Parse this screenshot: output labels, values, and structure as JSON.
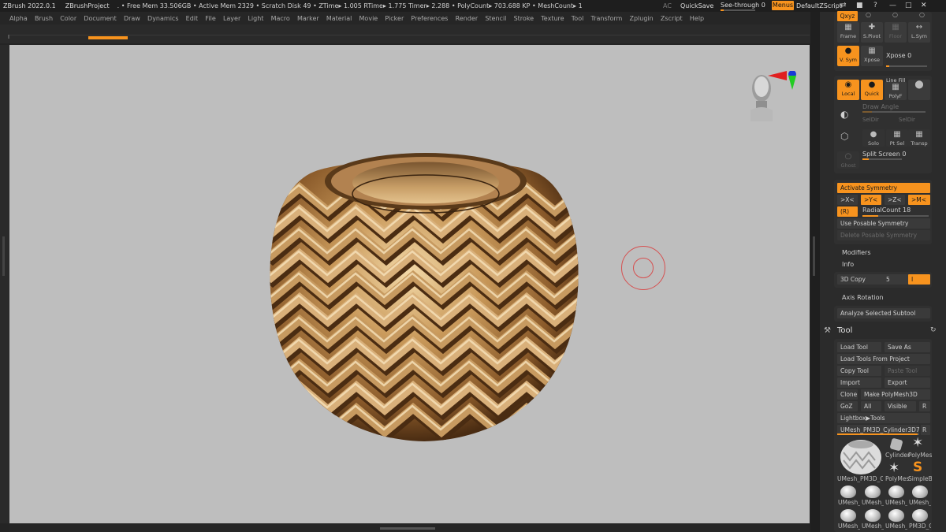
{
  "titlebar": {
    "app": "ZBrush 2022.0.1",
    "project": "ZBrushProject",
    "stats": ". • Free Mem 33.506GB • Active Mem 2329 • Scratch Disk 49 • ZTime▸ 1.005 RTime▸ 1.775 Timer▸ 2.288 • PolyCount▸ 703.688 KP • MeshCount▸ 1",
    "ac": "AC",
    "quicksave": "QuickSave",
    "see_through": "See-through  0",
    "menus": "Menus",
    "default_zscript": "DefaultZScript"
  },
  "menubar": [
    "Alpha",
    "Brush",
    "Color",
    "Document",
    "Draw",
    "Dynamics",
    "Edit",
    "File",
    "Layer",
    "Light",
    "Macro",
    "Marker",
    "Material",
    "Movie",
    "Picker",
    "Preferences",
    "Render",
    "Stencil",
    "Stroke",
    "Texture",
    "Tool",
    "Transform",
    "Zplugin",
    "Zscript",
    "Help"
  ],
  "transform": {
    "xyz": "Qxyz",
    "frame": "Frame",
    "s_pivot": "S.Pivot",
    "floor": "Floor",
    "l_sym": "L.Sym",
    "v_sym": "V. Sym",
    "xpose_btn": "Xpose",
    "xpose_slider": "Xpose 0",
    "local": "Local",
    "quick": "Quick",
    "line_fill": "Line Fill",
    "polyf": "PolyF",
    "draw_angle": "Draw Angle",
    "sel_dir_a": "SelDir",
    "sel_dir_b": "SelDir",
    "solo": "Solo",
    "pt_sel": "Pt Sel",
    "transp": "Transp",
    "ghost": "Ghost",
    "split_screen": "Split Screen 0",
    "activate_symmetry": "Activate Symmetry",
    "x_axis": ">X<",
    "y_axis": ">Y<",
    "z_axis": ">Z<",
    "m_axis": ">M<",
    "radial_r": "(R)",
    "radial_count": "RadialCount 18",
    "use_posable": "Use Posable Symmetry",
    "delete_posable": "Delete Posable Symmetry",
    "modifiers": "Modifiers",
    "info": "Info",
    "copy_3d": "3D Copy",
    "copy_3d_val": "5",
    "copy_3d_flag": "I",
    "axis_rotation": "Axis Rotation",
    "analyze": "Analyze Selected Subtool"
  },
  "tool": {
    "header": "Tool",
    "load_tool": "Load Tool",
    "save_as": "Save As",
    "load_from_project": "Load Tools From Project",
    "copy_tool": "Copy Tool",
    "paste_tool": "Paste Tool",
    "import": "Import",
    "export": "Export",
    "clone": "Clone",
    "make_polymesh": "Make PolyMesh3D",
    "goz": "GoZ",
    "all": "All",
    "visible": "Visible",
    "r": "R",
    "lightbox": "Lightbox▶Tools",
    "current": "UMesh_PM3D_Cylinder3D7.",
    "current_r": "R",
    "thumbs": {
      "main": "UMesh_PM3D_C",
      "cylinder": "Cylinder",
      "polymes_a": "PolyMes",
      "polymes_b": "PolyMes",
      "simpleb": "SimpleB",
      "row1": [
        "UMesh_",
        "UMesh_",
        "UMesh_",
        "UMesh_"
      ],
      "row2": [
        "UMesh_",
        "UMesh_",
        "UMesh_",
        "PM3D_C"
      ]
    }
  },
  "colors": {
    "accent": "#f7931e",
    "canvas": "#bebebe",
    "panel": "#2b2b2b",
    "bronze": "#b98a4e"
  }
}
